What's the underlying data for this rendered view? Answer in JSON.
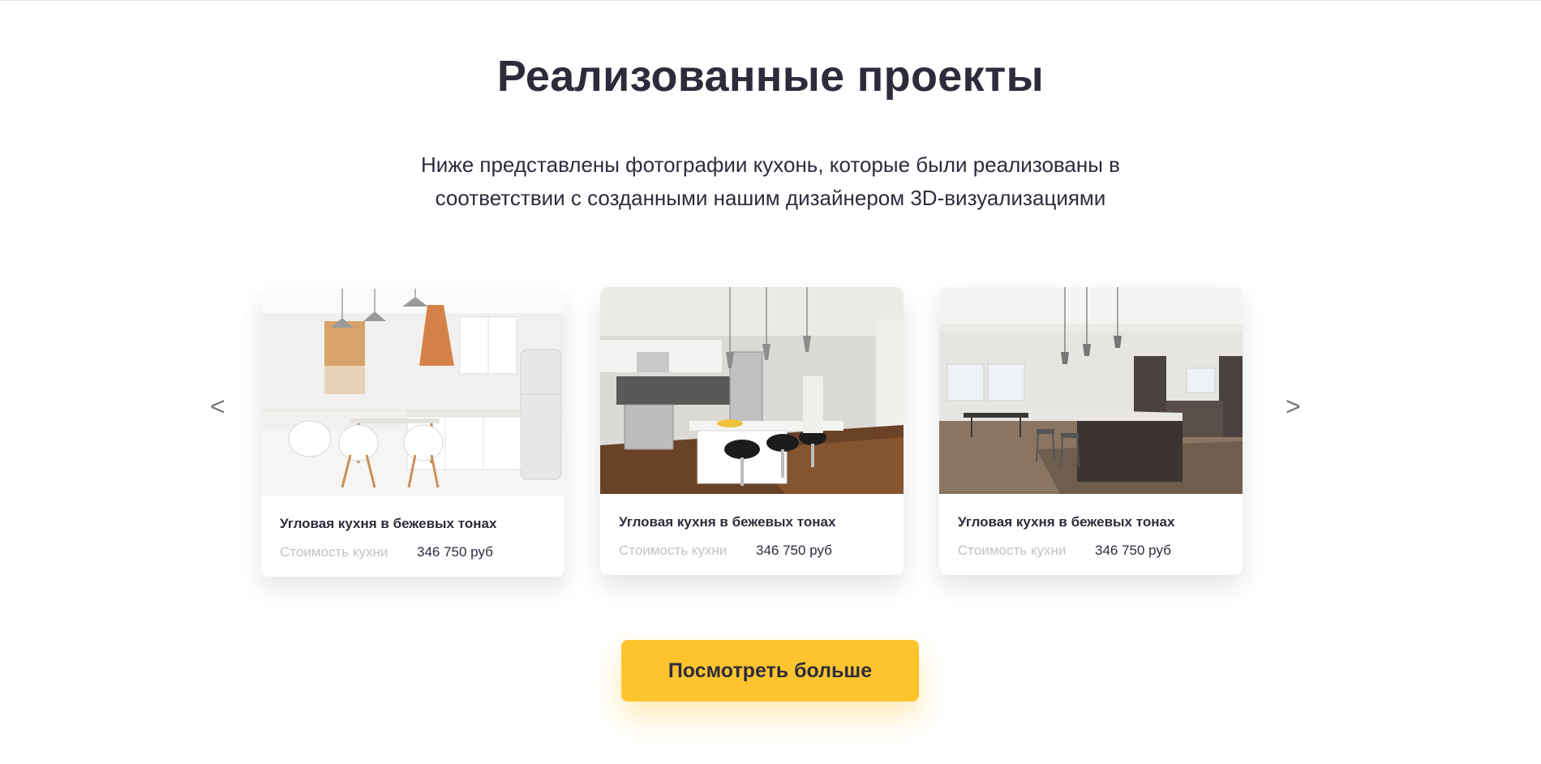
{
  "section": {
    "title": "Реализованные проекты",
    "subtitle": "Ниже представлены фотографии кухонь, которые были реализованы в соответствии с созданными нашим дизайнером 3D-визуализациями"
  },
  "carousel": {
    "prev_label": "<",
    "next_label": ">",
    "cards": [
      {
        "photo": "kitchen-photo-white-scandinavian",
        "title": "Угловая кухня в бежевых тонах",
        "price_label": "Стоимость кухни",
        "price_value": "346 750 руб"
      },
      {
        "photo": "kitchen-photo-white-island-bar-stools",
        "title": "Угловая кухня в бежевых тонах",
        "price_label": "Стоимость кухни",
        "price_value": "346 750 руб"
      },
      {
        "photo": "kitchen-photo-dark-island-open-plan",
        "title": "Угловая кухня в бежевых тонах",
        "price_label": "Стоимость кухни",
        "price_value": "346 750 руб"
      }
    ]
  },
  "cta": {
    "label": "Посмотреть больше"
  },
  "colors": {
    "accent": "#ffc42e",
    "text": "#2d2c3c",
    "muted": "#c2c2c8"
  }
}
